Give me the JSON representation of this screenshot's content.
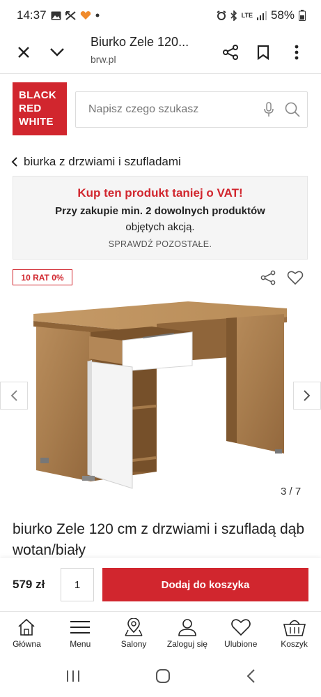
{
  "status_bar": {
    "time": "14:37",
    "battery": "58%",
    "network": "LTE"
  },
  "browser": {
    "page_title": "Biurko Zele 120...",
    "url": "brw.pl"
  },
  "brand": {
    "logo_lines": [
      "BLACK",
      "RED",
      "WHITE"
    ],
    "accent": "#d1262e"
  },
  "search": {
    "placeholder": "Napisz czego szukasz"
  },
  "breadcrumb": {
    "label": "biurka z drzwiami i szufladami"
  },
  "promo": {
    "headline": "Kup ten produkt taniej o VAT!",
    "line1": "Przy zakupie min. 2 dowolnych produktów",
    "line2": "objętych akcją.",
    "link": "SPRAWDŹ POZOSTAŁE."
  },
  "badge": "10 RAT 0%",
  "gallery": {
    "counter": "3 / 7"
  },
  "product": {
    "title": "biurko Zele 120 cm z drzwiami i szufladą dąb wotan/biały"
  },
  "buy": {
    "price": "579 zł",
    "quantity": "1",
    "add_label": "Dodaj do koszyka"
  },
  "bottom_nav": [
    {
      "label": "Główna",
      "icon": "home-icon"
    },
    {
      "label": "Menu",
      "icon": "menu-icon"
    },
    {
      "label": "Salony",
      "icon": "location-icon"
    },
    {
      "label": "Zaloguj się",
      "icon": "user-icon"
    },
    {
      "label": "Ulubione",
      "icon": "heart-icon"
    },
    {
      "label": "Koszyk",
      "icon": "basket-icon"
    }
  ]
}
